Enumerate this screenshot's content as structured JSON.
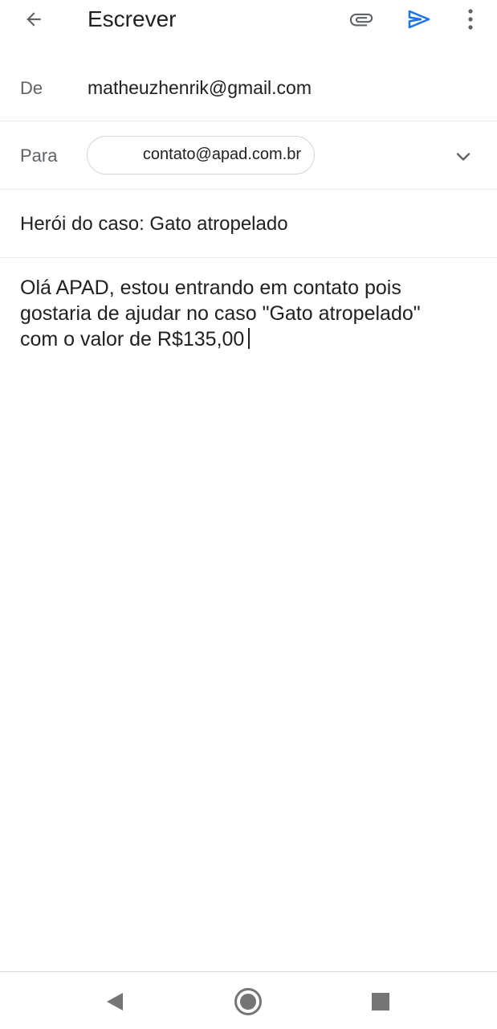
{
  "appbar": {
    "title": "Escrever",
    "icons": {
      "back": "arrow-back-icon",
      "attach": "paperclip-icon",
      "send": "send-icon",
      "more": "more-vertical-icon"
    },
    "accent_color": "#1a73e8"
  },
  "from": {
    "label": "De",
    "value": "matheuzhenrik@gmail.com"
  },
  "to": {
    "label": "Para",
    "recipients": [
      "contato@apad.com.br"
    ],
    "expand_icon": "chevron-down-icon"
  },
  "subject": {
    "value": "Herói do caso: Gato atropelado"
  },
  "body": {
    "lines": [
      "Olá APAD, estou entrando em contato pois",
      "gostaria de ajudar no caso \"Gato atropelado\"",
      "com o valor de R$135,00"
    ]
  },
  "navbar": {
    "icons": {
      "back": "nav-back-triangle-icon",
      "home": "nav-home-circle-icon",
      "recents": "nav-recents-square-icon"
    }
  }
}
